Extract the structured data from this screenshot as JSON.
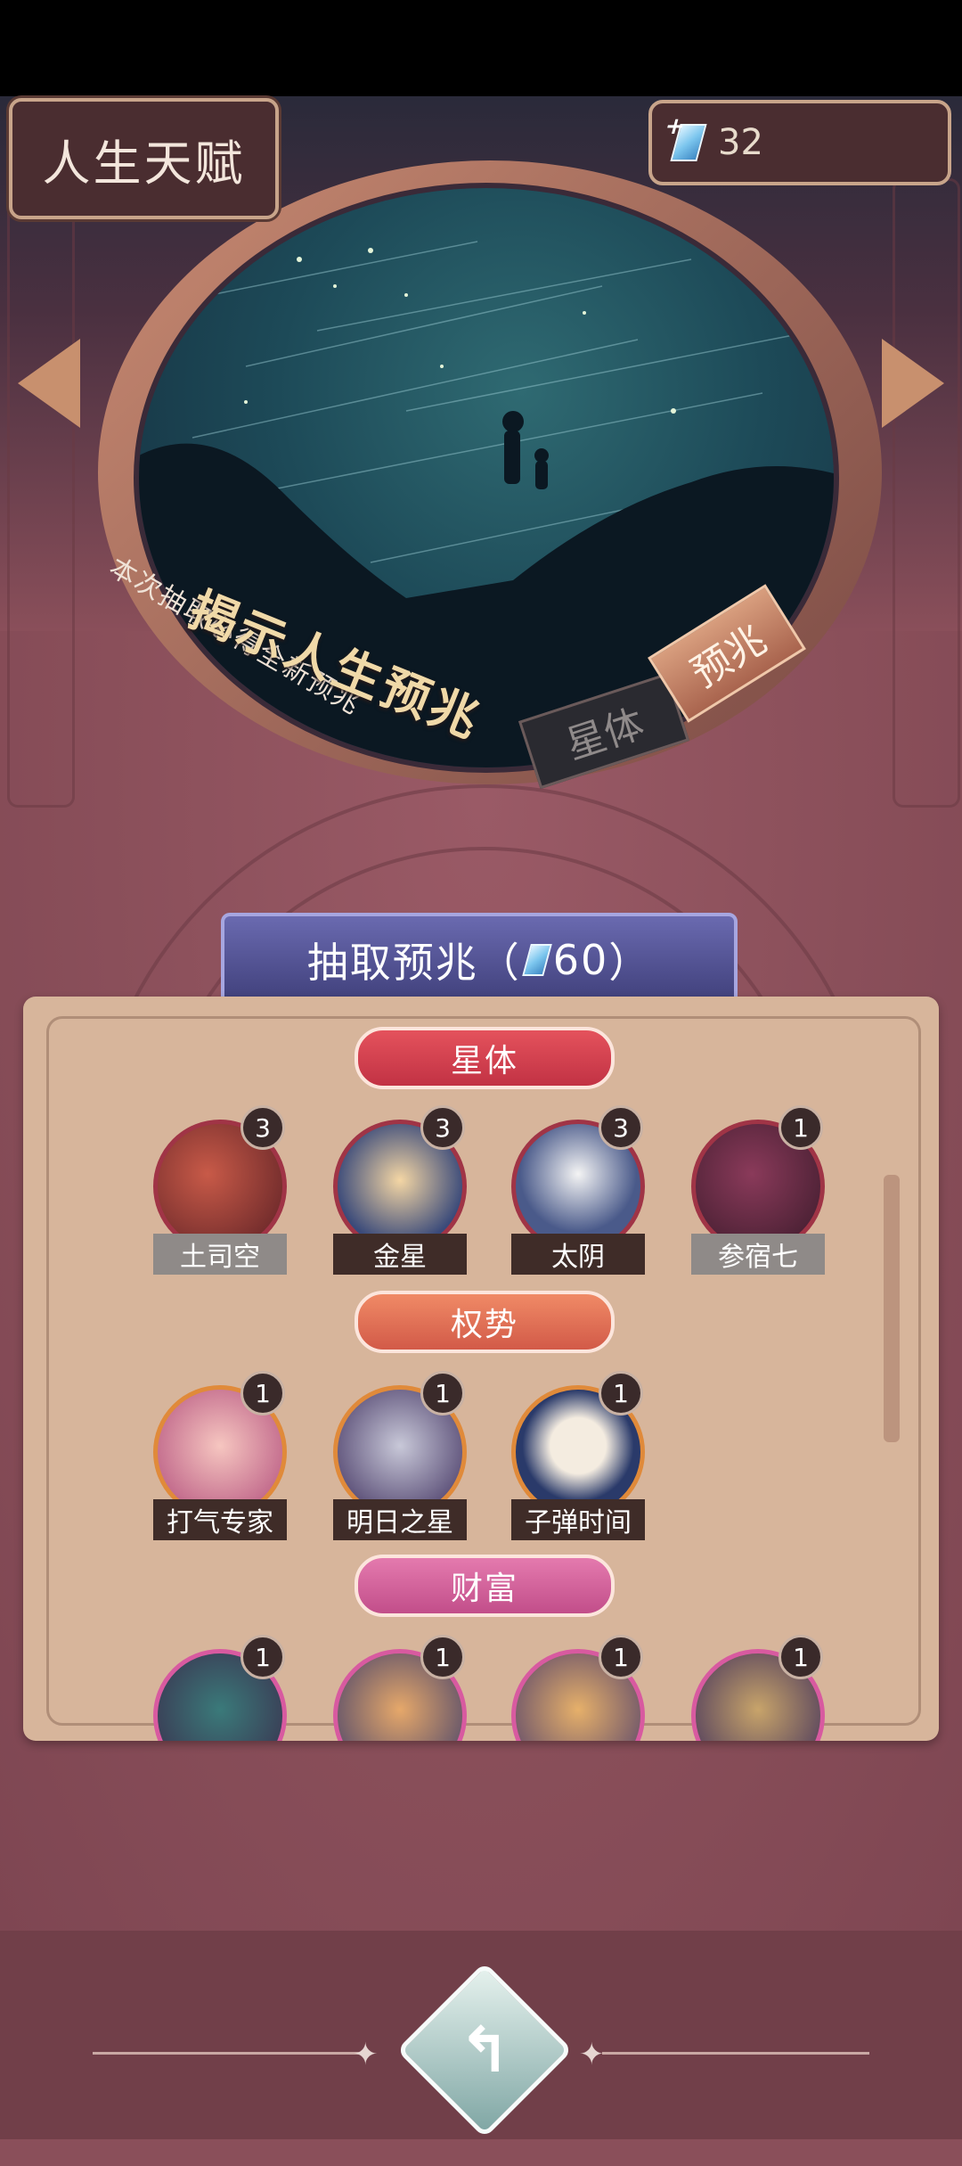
{
  "header": {
    "title": "人生天赋",
    "currency": {
      "icon": "crystal-icon",
      "amount": "32"
    }
  },
  "banner": {
    "headline": "揭示人生预兆",
    "subtitle": "本次抽取必得全新预兆",
    "tabs": [
      {
        "label": "星体",
        "active": false
      },
      {
        "label": "预兆",
        "active": true
      }
    ]
  },
  "draw": {
    "label": "抽取预兆（",
    "cost": "60",
    "close": "）"
  },
  "sections": [
    {
      "title": "星体",
      "items": [
        {
          "name": "土司空",
          "count": "3",
          "owned": false
        },
        {
          "name": "金星",
          "count": "3",
          "owned": true
        },
        {
          "name": "太阴",
          "count": "3",
          "owned": true
        },
        {
          "name": "参宿七",
          "count": "1",
          "owned": false
        }
      ]
    },
    {
      "title": "权势",
      "items": [
        {
          "name": "打气专家",
          "count": "1",
          "owned": true
        },
        {
          "name": "明日之星",
          "count": "1",
          "owned": true
        },
        {
          "name": "子弹时间",
          "count": "1",
          "owned": true
        }
      ]
    },
    {
      "title": "财富",
      "items": [
        {
          "name": "",
          "count": "1",
          "owned": true
        },
        {
          "name": "",
          "count": "1",
          "owned": true
        },
        {
          "name": "",
          "count": "1",
          "owned": true
        },
        {
          "name": "",
          "count": "1",
          "owned": true
        }
      ]
    }
  ],
  "footer": {
    "back_icon": "back-arrow-icon"
  },
  "colors": {
    "accent_red": "#c23244",
    "panel": "#d7b59b",
    "background": "#8a4f5a"
  }
}
